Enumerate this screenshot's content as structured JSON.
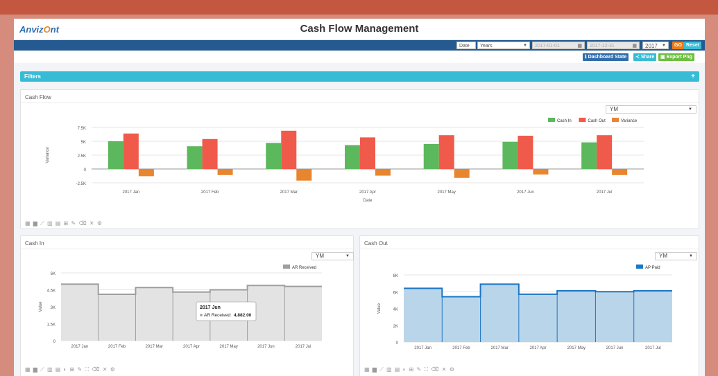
{
  "app": {
    "logo_text_a": "Anviz",
    "logo_text_o": "O",
    "logo_text_b": "nt",
    "title": "Cash Flow Management"
  },
  "controls": {
    "date_select": "Date ▾",
    "period_select": "Years",
    "start_date": "2017-01-01",
    "end_date": "2017-12-31",
    "year_select": "2017",
    "go_label": "GO",
    "reset_label": "Reset",
    "dashboard_state_label": "Dashboard State",
    "share_label": "Share",
    "export_label": "Export Png"
  },
  "filters": {
    "label": "Filters",
    "add": "+"
  },
  "colors": {
    "cash_in": "#5cb85c",
    "cash_out": "#f05a4a",
    "variance": "#e8852f",
    "ar": "#a8a8a8",
    "ap": "#1d75c4"
  },
  "cash_flow_panel": {
    "title": "Cash Flow",
    "period": "YM",
    "toolbar_icons": [
      "bar-chart-icon",
      "column-chart-icon",
      "line-chart-icon",
      "grouped-bar-icon",
      "stacked-bar-icon",
      "table-icon",
      "pencil-icon",
      "eraser-icon",
      "close-icon",
      "settings-icon"
    ],
    "chart_data": {
      "type": "bar",
      "categories": [
        "2017 Jan",
        "2017 Feb",
        "2017 Mar",
        "2017 Apr",
        "2017 May",
        "2017 Jun",
        "2017 Jul"
      ],
      "series": [
        {
          "name": "Cash In",
          "values": [
            5000,
            4100,
            4700,
            4300,
            4500,
            4900,
            4800
          ]
        },
        {
          "name": "Cash Out",
          "values": [
            6400,
            5400,
            6900,
            5700,
            6100,
            6000,
            6100
          ]
        },
        {
          "name": "Variance",
          "values": [
            -1300,
            -1100,
            -2100,
            -1200,
            -1600,
            -1000,
            -1100
          ]
        }
      ],
      "xlabel": "Date",
      "ylabel": "Variance",
      "yticks": [
        "7.5K",
        "5K",
        "2.5K",
        "0",
        "-2.5K"
      ],
      "ytick_values": [
        7500,
        5000,
        2500,
        0,
        -2500
      ],
      "ylim": [
        -2500,
        7500
      ],
      "legend": "top-right"
    }
  },
  "cash_in_panel": {
    "title": "Cash In",
    "period": "YM",
    "toolbar_icons": [
      "bar-chart-icon",
      "column-chart-icon",
      "line-chart-icon",
      "grouped-bar-icon",
      "stacked-bar-icon",
      "pie-chart-icon",
      "table-icon",
      "pencil-icon",
      "expand-icon",
      "eraser-icon",
      "close-icon",
      "settings-icon"
    ],
    "tooltip": {
      "title": "2017 Jun",
      "label": "AR Received:",
      "value": "4,882.00"
    },
    "chart_data": {
      "type": "area",
      "categories": [
        "2017 Jan",
        "2017 Feb",
        "2017 Mar",
        "2017 Apr",
        "2017 May",
        "2017 Jun",
        "2017 Jul"
      ],
      "series": [
        {
          "name": "AR Received",
          "values": [
            5000,
            4100,
            4700,
            4300,
            4500,
            4882,
            4800
          ]
        }
      ],
      "ylabel": "Value",
      "yticks": [
        "6K",
        "4.5K",
        "3K",
        "1.5K",
        "0"
      ],
      "ytick_values": [
        6000,
        4500,
        3000,
        1500,
        0
      ],
      "ylim": [
        0,
        6000
      ],
      "legend": "top-right"
    }
  },
  "cash_out_panel": {
    "title": "Cash Out",
    "period": "YM",
    "toolbar_icons": [
      "bar-chart-icon",
      "column-chart-icon",
      "line-chart-icon",
      "grouped-bar-icon",
      "stacked-bar-icon",
      "pie-chart-icon",
      "table-icon",
      "pencil-icon",
      "expand-icon",
      "eraser-icon",
      "close-icon",
      "settings-icon"
    ],
    "chart_data": {
      "type": "area",
      "categories": [
        "2017 Jan",
        "2017 Feb",
        "2017 Mar",
        "2017 Apr",
        "2017 May",
        "2017 Jun",
        "2017 Jul"
      ],
      "series": [
        {
          "name": "AP Paid",
          "values": [
            6400,
            5400,
            6900,
            5700,
            6100,
            6000,
            6100
          ]
        }
      ],
      "ylabel": "Value",
      "yticks": [
        "8K",
        "6K",
        "4K",
        "2K",
        "0"
      ],
      "ytick_values": [
        8000,
        6000,
        4000,
        2000,
        0
      ],
      "ylim": [
        0,
        8000
      ],
      "legend": "top-right"
    }
  }
}
